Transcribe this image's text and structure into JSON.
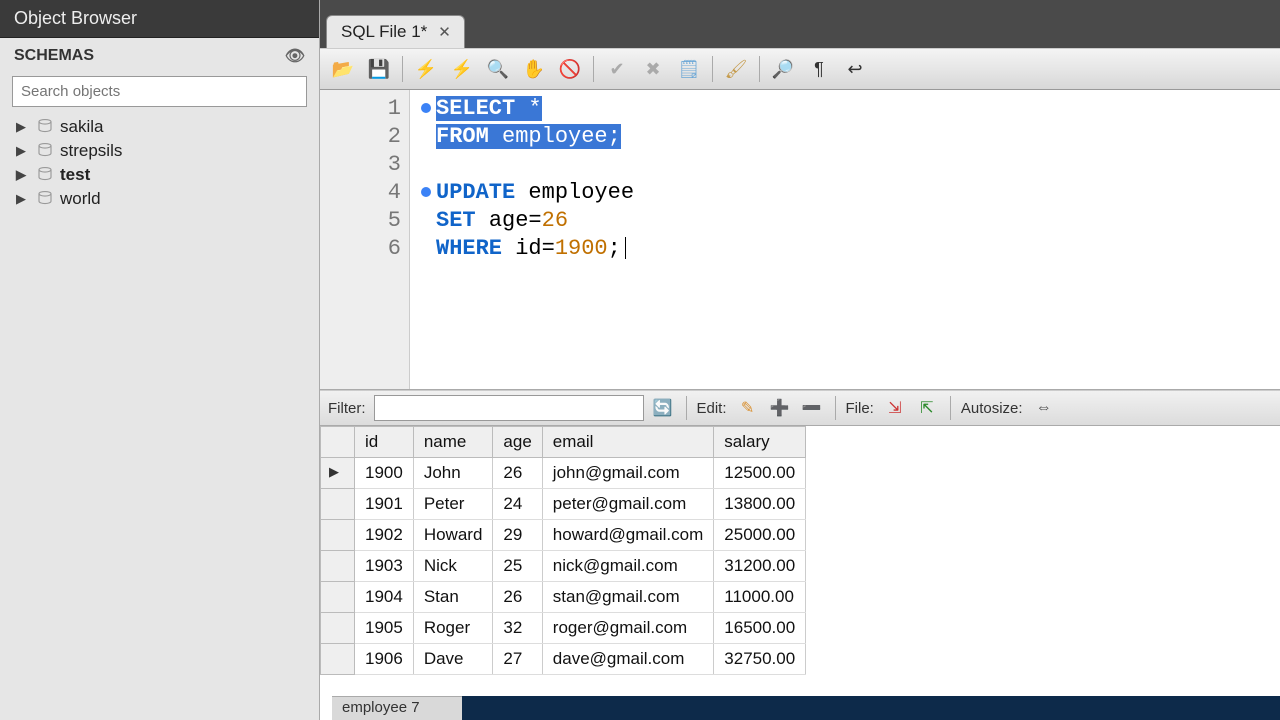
{
  "sidebar": {
    "title": "Object Browser",
    "section_label": "SCHEMAS",
    "search_placeholder": "Search objects",
    "items": [
      {
        "label": "sakila",
        "bold": false
      },
      {
        "label": "strepsils",
        "bold": false
      },
      {
        "label": "test",
        "bold": true
      },
      {
        "label": "world",
        "bold": false
      }
    ]
  },
  "tabs": {
    "active": {
      "label": "SQL File 1*"
    }
  },
  "sql": {
    "lines": [
      {
        "n": "1",
        "dot": true,
        "tokens": [
          {
            "t": "SELECT",
            "c": "kw",
            "sel": true
          },
          {
            "t": " ",
            "c": "txt",
            "sel": true
          },
          {
            "t": "*",
            "c": "txt",
            "sel": true
          }
        ]
      },
      {
        "n": "2",
        "dot": false,
        "tokens": [
          {
            "t": "FROM",
            "c": "kw",
            "sel": true
          },
          {
            "t": " ",
            "c": "txt",
            "sel": true
          },
          {
            "t": "employee;",
            "c": "ident",
            "sel": true
          }
        ]
      },
      {
        "n": "3",
        "dot": false,
        "tokens": []
      },
      {
        "n": "4",
        "dot": true,
        "tokens": [
          {
            "t": "UPDATE",
            "c": "kw"
          },
          {
            "t": " ",
            "c": "txt"
          },
          {
            "t": "employee",
            "c": "ident"
          }
        ]
      },
      {
        "n": "5",
        "dot": false,
        "tokens": [
          {
            "t": "SET",
            "c": "kw"
          },
          {
            "t": " ",
            "c": "txt"
          },
          {
            "t": "age=",
            "c": "ident"
          },
          {
            "t": "26",
            "c": "num"
          }
        ]
      },
      {
        "n": "6",
        "dot": false,
        "tokens": [
          {
            "t": "WHERE",
            "c": "kw"
          },
          {
            "t": " ",
            "c": "txt"
          },
          {
            "t": "id=",
            "c": "ident"
          },
          {
            "t": "1900",
            "c": "num"
          },
          {
            "t": ";",
            "c": "txt"
          }
        ],
        "caret": true
      }
    ]
  },
  "results": {
    "filter_label": "Filter:",
    "filter_value": "",
    "edit_label": "Edit:",
    "file_label": "File:",
    "autosize_label": "Autosize:",
    "columns": [
      "id",
      "name",
      "age",
      "email",
      "salary"
    ],
    "rows": [
      {
        "id": "1900",
        "name": "John",
        "age": "26",
        "email": "john@gmail.com",
        "salary": "12500.00",
        "current": true
      },
      {
        "id": "1901",
        "name": "Peter",
        "age": "24",
        "email": "peter@gmail.com",
        "salary": "13800.00"
      },
      {
        "id": "1902",
        "name": "Howard",
        "age": "29",
        "email": "howard@gmail.com",
        "salary": "25000.00"
      },
      {
        "id": "1903",
        "name": "Nick",
        "age": "25",
        "email": "nick@gmail.com",
        "salary": "31200.00"
      },
      {
        "id": "1904",
        "name": "Stan",
        "age": "26",
        "email": "stan@gmail.com",
        "salary": "11000.00"
      },
      {
        "id": "1905",
        "name": "Roger",
        "age": "32",
        "email": "roger@gmail.com",
        "salary": "16500.00"
      },
      {
        "id": "1906",
        "name": "Dave",
        "age": "27",
        "email": "dave@gmail.com",
        "salary": "32750.00"
      }
    ]
  },
  "status": {
    "text": "employee 7"
  }
}
